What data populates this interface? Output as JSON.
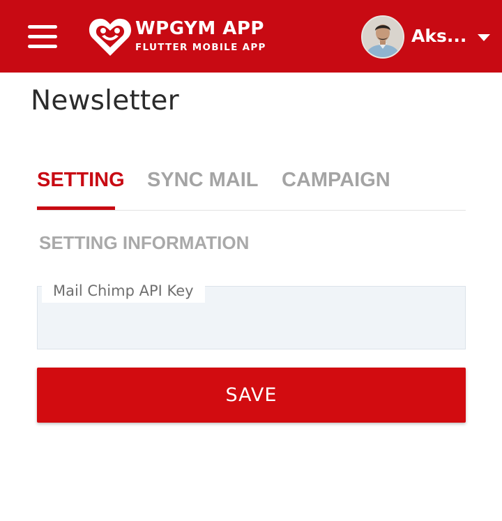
{
  "colors": {
    "brand_red": "#c80a13",
    "tab_inactive": "#a4a4a4",
    "field_bg": "#f0f4f8"
  },
  "appbar": {
    "menu_icon": "hamburger-menu-icon",
    "logo": {
      "title": "WPGYM APP",
      "subtitle": "FLUTTER MOBILE APP",
      "mark_icon": "heart-people-logo-icon"
    },
    "user": {
      "name": "Aks...",
      "dropdown_icon": "caret-down-icon"
    }
  },
  "page": {
    "title": "Newsletter"
  },
  "tabs": [
    {
      "label": "SETTING",
      "active": true
    },
    {
      "label": "SYNC MAIL",
      "active": false
    },
    {
      "label": "CAMPAIGN",
      "active": false
    }
  ],
  "section": {
    "title": "SETTING INFORMATION"
  },
  "form": {
    "api_key_label": "Mail Chimp API Key",
    "api_key_value": "",
    "save_label": "SAVE"
  }
}
